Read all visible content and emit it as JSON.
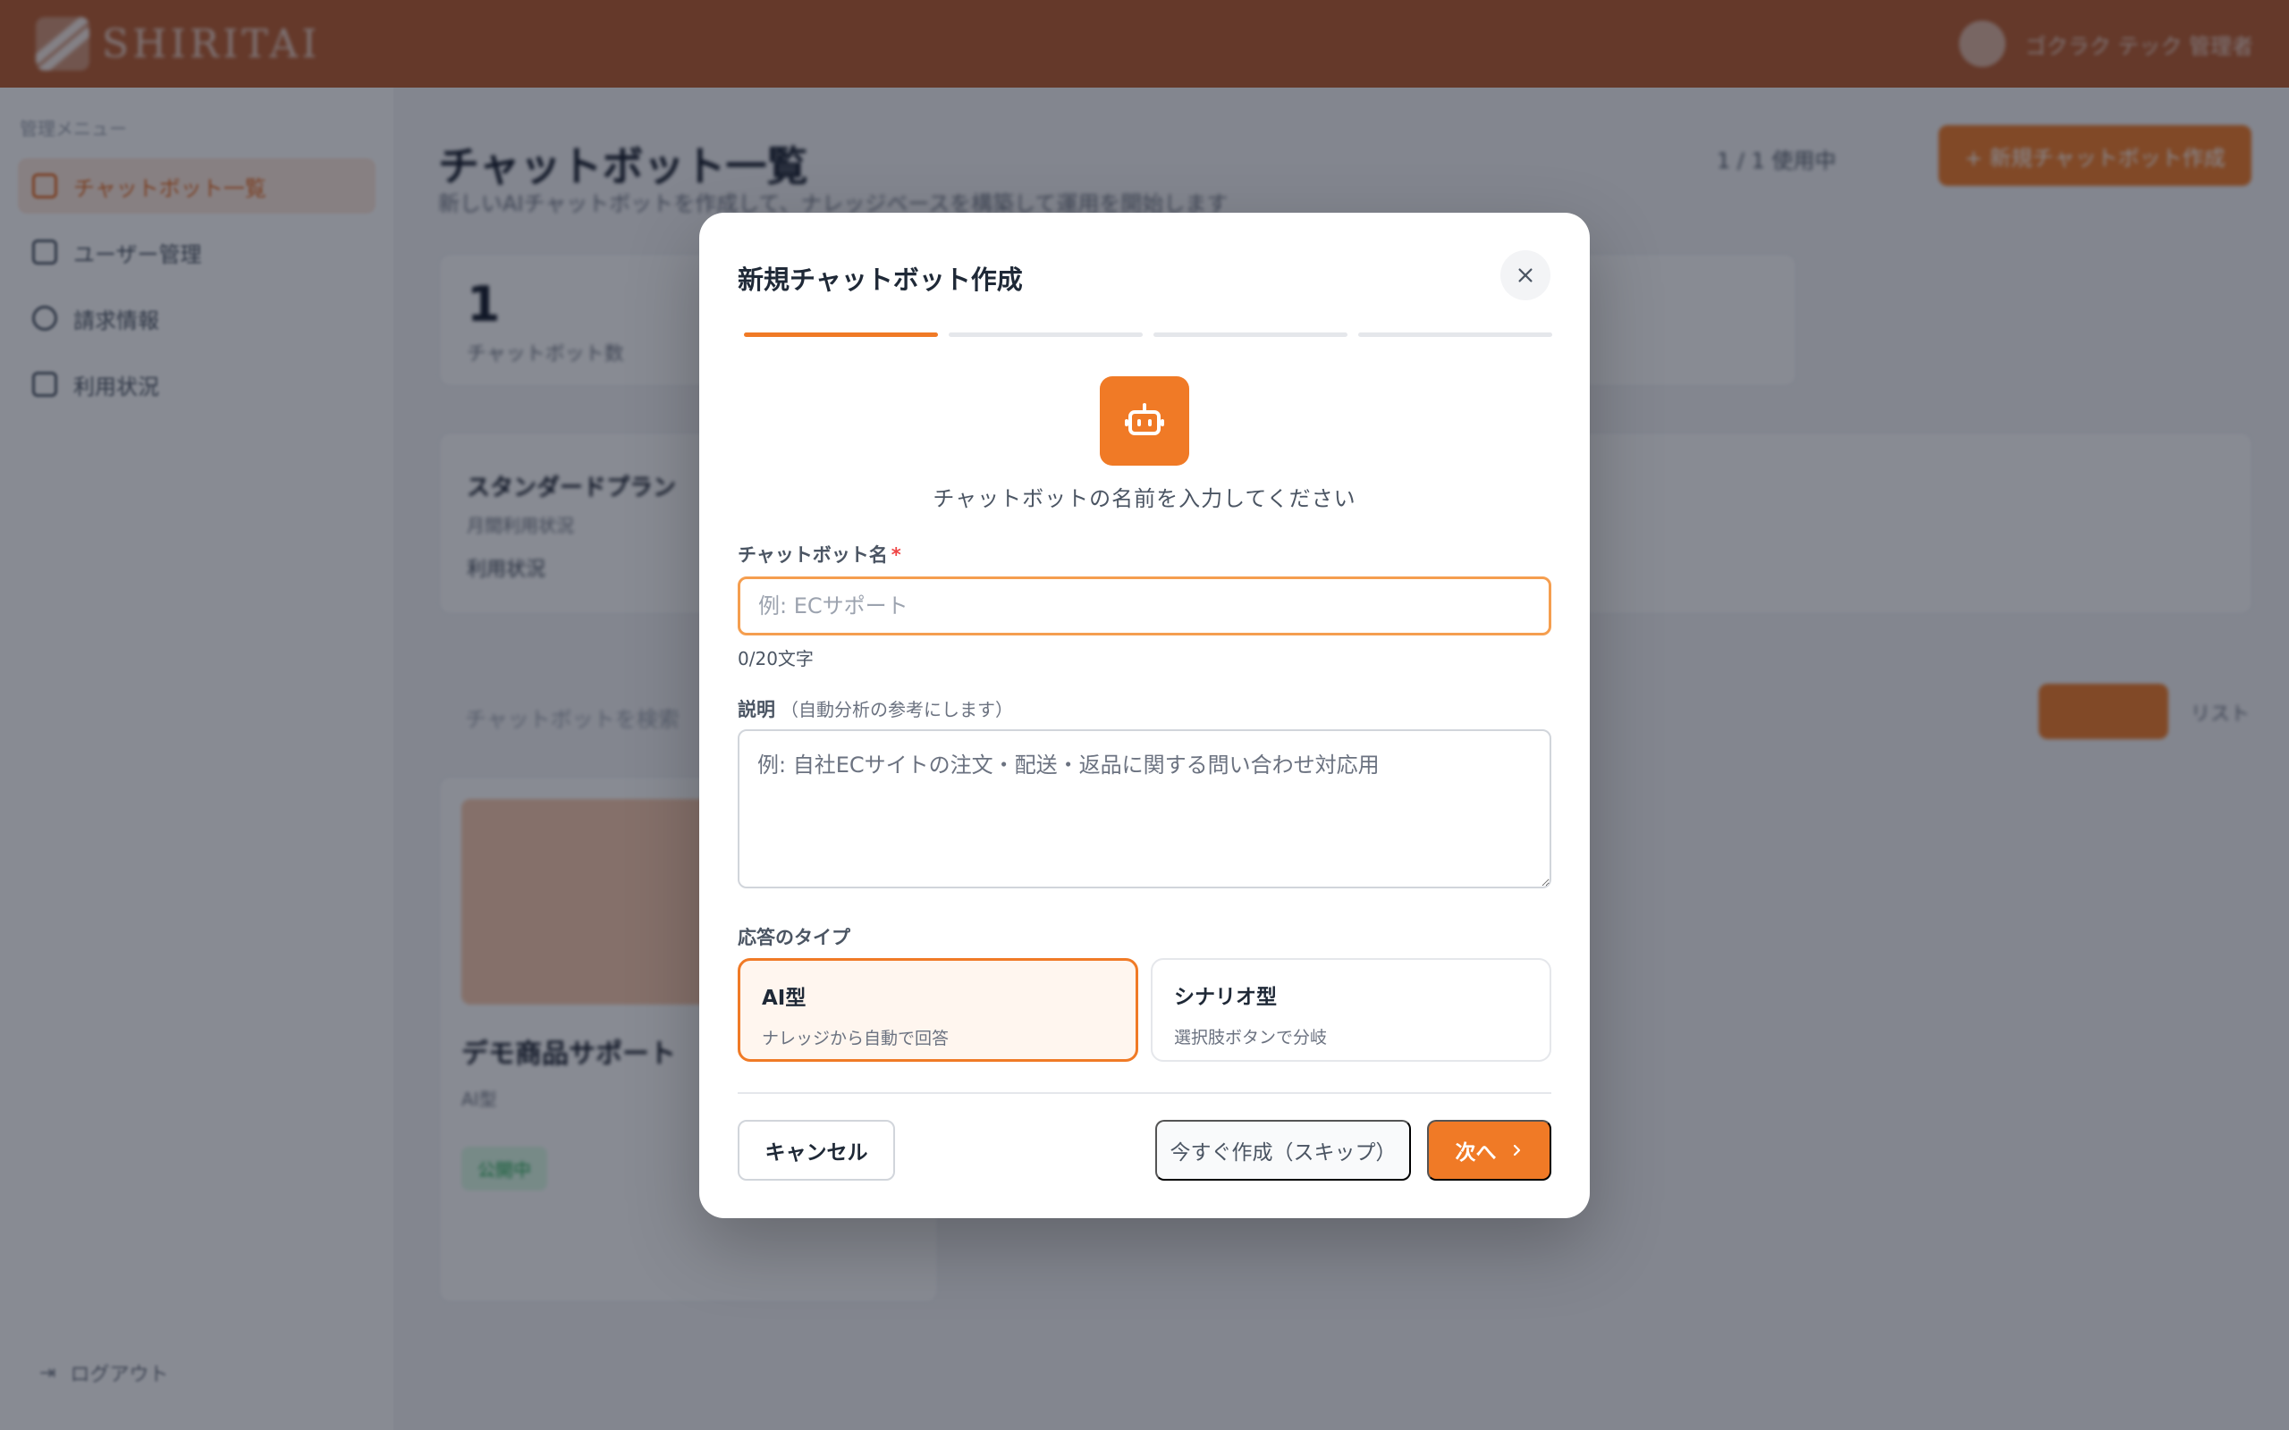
{
  "app": {
    "logo_text": "SHIRITAI",
    "user_label": "ゴクラク テック 管理者",
    "sidebar": {
      "section_label": "管理メニュー",
      "items": [
        {
          "label": "チャットボット一覧",
          "icon": "grid-icon",
          "active": true
        },
        {
          "label": "ユーザー管理",
          "icon": "users-icon",
          "active": false
        },
        {
          "label": "請求情報",
          "icon": "settings-icon",
          "active": false
        },
        {
          "label": "利用状況",
          "icon": "chart-icon",
          "active": false
        }
      ],
      "logout_label": "ログアウト"
    },
    "page": {
      "title": "チャットボット一覧",
      "subtitle": "新しいAIチャットボットを作成して、ナレッジベースを構築して運用を開始します",
      "head_links": "1 / 1 使用中",
      "create_button": "+ 新規チャットボット作成",
      "stat_value": "1",
      "stat_label": "チャットボット数",
      "plan_title": "スタンダードプラン",
      "plan_sub": "月間利用状況",
      "plan_row": "利用状況",
      "search_hint": "チャットボットを検索",
      "view_alt": "リスト",
      "bot_name": "デモ商品サポート",
      "bot_meta": "AI型",
      "bot_badge": "公開中"
    }
  },
  "modal": {
    "title": "新規チャットボット作成",
    "steps_total": 4,
    "current_step": 1,
    "intro": "チャットボットの名前を入力してください",
    "name_label": "チャットボット名",
    "required_mark": "*",
    "name_placeholder": "例: ECサポート",
    "name_value": "",
    "name_counter": "0/20文字",
    "desc_label": "説明",
    "desc_sublabel": "（自動分析の参考にします）",
    "desc_placeholder": "例: 自社ECサイトの注文・配送・返品に関する問い合わせ対応用",
    "type_label": "応答のタイプ",
    "types": [
      {
        "title": "AI型",
        "desc": "ナレッジから自動で回答",
        "selected": true
      },
      {
        "title": "シナリオ型",
        "desc": "選択肢ボタンで分岐",
        "selected": false
      }
    ],
    "cancel_label": "キャンセル",
    "skip_label": "今すぐ作成（スキップ）",
    "next_label": "次へ"
  },
  "colors": {
    "accent": "#f07a26",
    "topbar": "#b85a2c",
    "overlay": "rgba(17,24,39,0.5)"
  }
}
